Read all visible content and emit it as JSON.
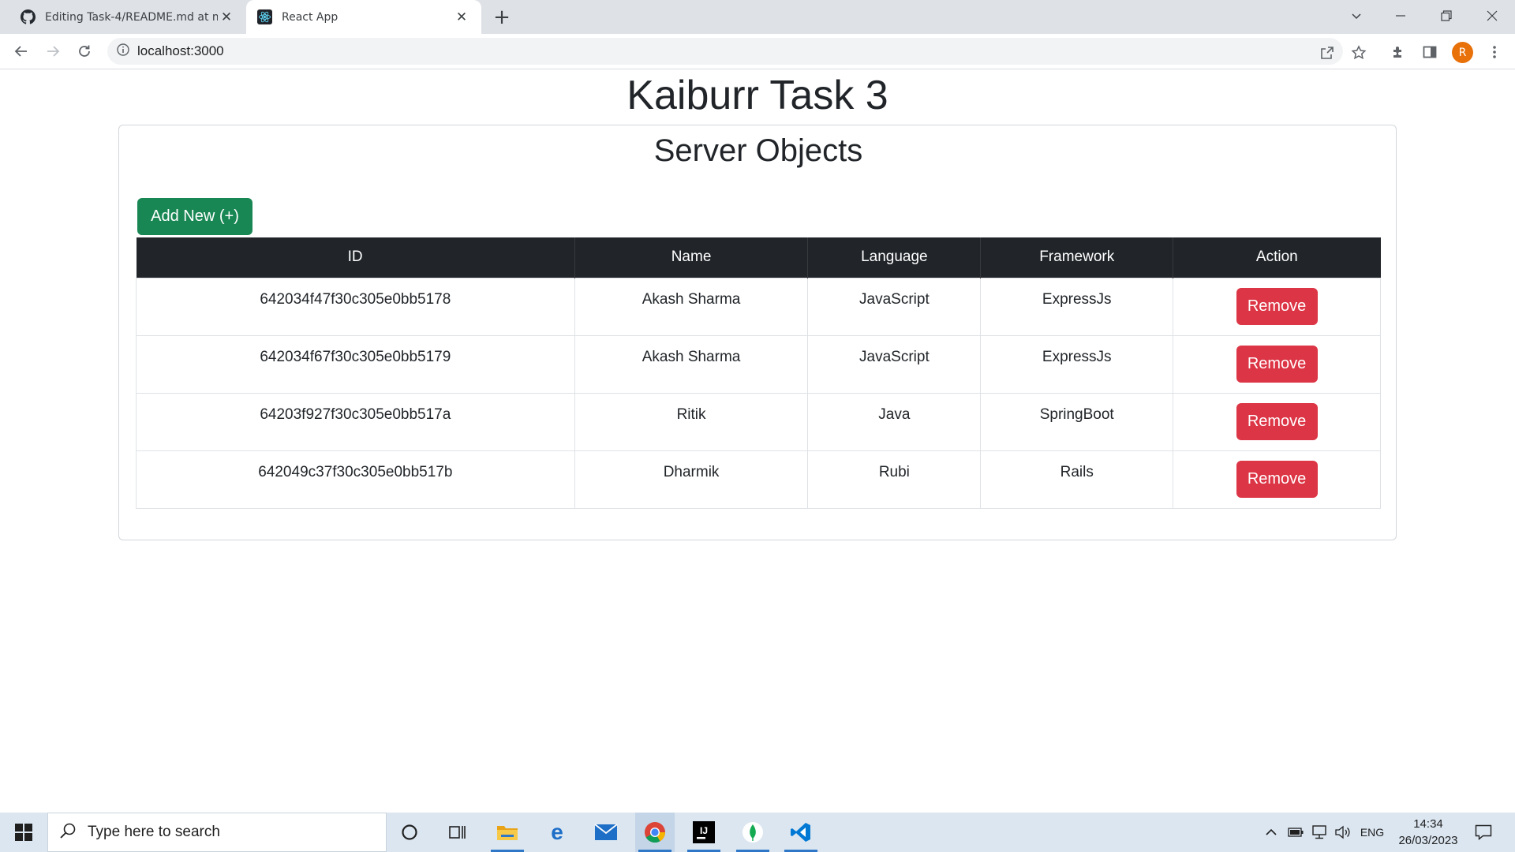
{
  "browser": {
    "tabs": [
      {
        "title": "Editing Task-4/README.md at m",
        "icon": "github-icon"
      },
      {
        "title": "React App",
        "icon": "react-icon"
      }
    ],
    "url": "localhost:3000"
  },
  "page": {
    "title": "Kaiburr Task 3",
    "card_title": "Server Objects",
    "add_button": "Add New (+)",
    "table": {
      "headers": [
        "ID",
        "Name",
        "Language",
        "Framework",
        "Action"
      ],
      "rows": [
        {
          "id": "642034f47f30c305e0bb5178",
          "name": "Akash Sharma",
          "language": "JavaScript",
          "framework": "ExpressJs",
          "action": "Remove"
        },
        {
          "id": "642034f67f30c305e0bb5179",
          "name": "Akash Sharma",
          "language": "JavaScript",
          "framework": "ExpressJs",
          "action": "Remove"
        },
        {
          "id": "64203f927f30c305e0bb517a",
          "name": "Ritik",
          "language": "Java",
          "framework": "SpringBoot",
          "action": "Remove"
        },
        {
          "id": "642049c37f30c305e0bb517b",
          "name": "Dharmik",
          "language": "Rubi",
          "framework": "Rails",
          "action": "Remove"
        }
      ]
    }
  },
  "taskbar": {
    "search_placeholder": "Type here to search",
    "language": "ENG",
    "time": "14:34",
    "date": "26/03/2023"
  },
  "colors": {
    "success": "#198754",
    "danger": "#dc3545",
    "table_header": "#212529"
  }
}
